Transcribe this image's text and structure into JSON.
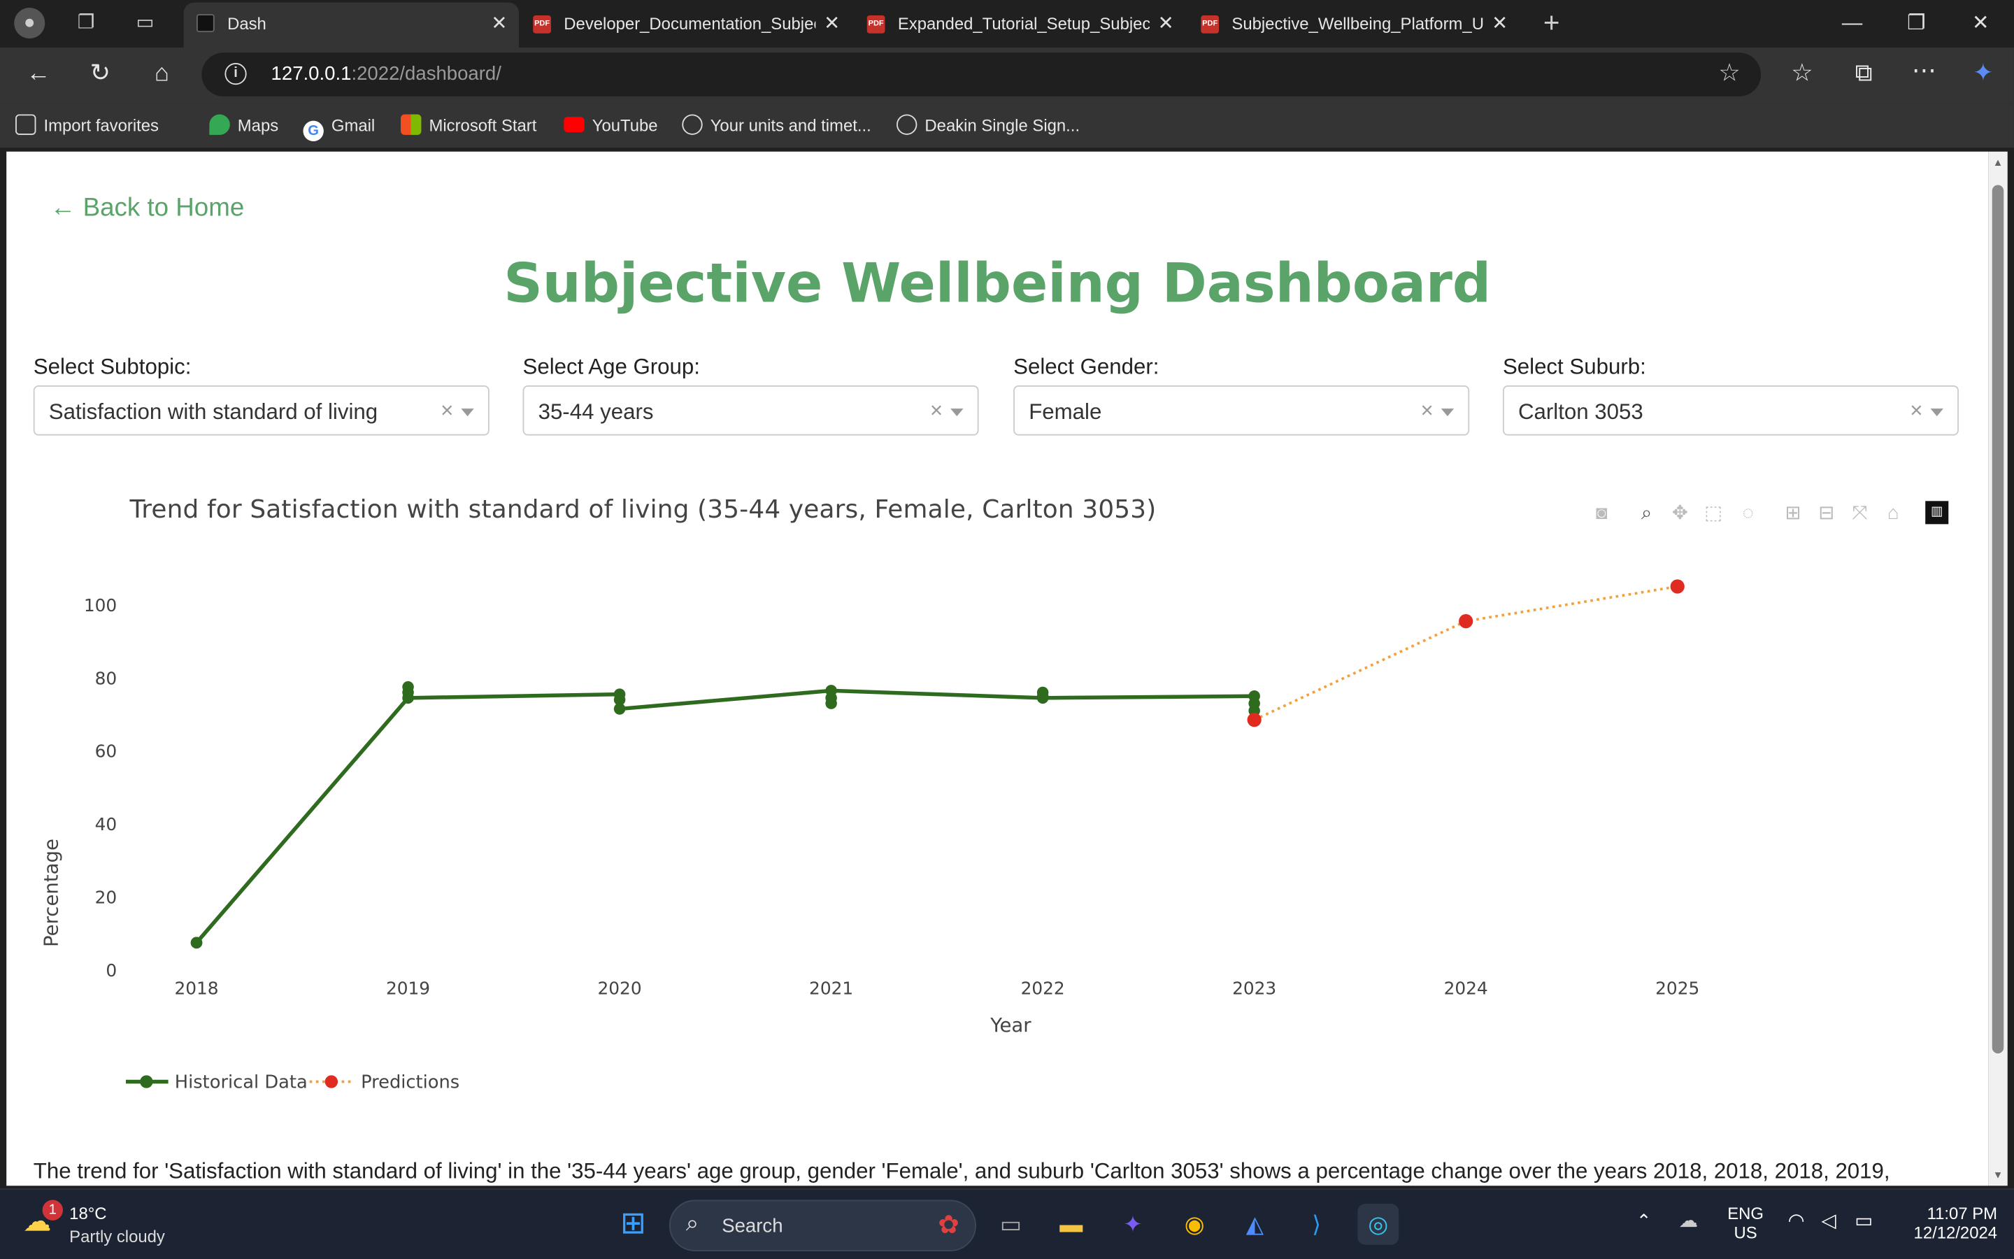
{
  "browser": {
    "tabs": [
      {
        "title": "Dash",
        "active": true
      },
      {
        "title": "Developer_Documentation_Subjec",
        "active": false
      },
      {
        "title": "Expanded_Tutorial_Setup_Subject",
        "active": false
      },
      {
        "title": "Subjective_Wellbeing_Platform_Us",
        "active": false
      }
    ],
    "url_host": "127.0.0.1",
    "url_path": ":2022/dashboard/",
    "bookmarks": [
      "Import favorites",
      "Maps",
      "Gmail",
      "Microsoft Start",
      "YouTube",
      "Your units and timet...",
      "Deakin Single Sign..."
    ]
  },
  "page": {
    "back_link": "← Back to Home",
    "title": "Subjective Wellbeing Dashboard",
    "filters": [
      {
        "label": "Select Subtopic:",
        "value": "Satisfaction with standard of living"
      },
      {
        "label": "Select Age Group:",
        "value": "35-44 years"
      },
      {
        "label": "Select Gender:",
        "value": "Female"
      },
      {
        "label": "Select Suburb:",
        "value": "Carlton 3053"
      }
    ],
    "summary": "The trend for 'Satisfaction with standard of living' in the '35-44 years' age group, gender 'Female', and suburb 'Carlton 3053' shows a percentage change over the years 2018, 2018, 2018, 2019,"
  },
  "chart_data": {
    "type": "line",
    "title": "Trend for Satisfaction with standard of living (35-44 years, Female, Carlton 3053)",
    "xlabel": "Year",
    "ylabel": "Percentage",
    "xlim": [
      2017.83,
      2025.85
    ],
    "ylim": [
      -1,
      108
    ],
    "yticks": [
      0,
      20,
      40,
      60,
      80,
      100
    ],
    "xticks": [
      2018,
      2019,
      2020,
      2021,
      2022,
      2023,
      2024,
      2025
    ],
    "legend_position": "bottom-left",
    "series": [
      {
        "name": "Historical Data",
        "color": "#2f6b1f",
        "style": "solid",
        "points": [
          [
            2018,
            7.5
          ],
          [
            2018,
            7.5
          ],
          [
            2018,
            7.5
          ],
          [
            2019,
            77.5
          ],
          [
            2019,
            76
          ],
          [
            2019,
            74.5
          ],
          [
            2020,
            75.5
          ],
          [
            2020,
            74
          ],
          [
            2020,
            71.5
          ],
          [
            2021,
            76.5
          ],
          [
            2021,
            74.5
          ],
          [
            2021,
            73
          ],
          [
            2022,
            76
          ],
          [
            2022,
            75
          ],
          [
            2022,
            74.5
          ],
          [
            2023,
            75
          ],
          [
            2023,
            73
          ],
          [
            2023,
            71
          ]
        ],
        "line": [
          [
            2018,
            7.5
          ],
          [
            2019,
            74.5
          ],
          [
            2020,
            75.5
          ],
          [
            2020,
            71.5
          ],
          [
            2021,
            76.5
          ],
          [
            2022,
            74.5
          ],
          [
            2023,
            75
          ],
          [
            2023,
            71
          ]
        ]
      },
      {
        "name": "Predictions",
        "color": "#e02b20",
        "line_color": "#f2a03a",
        "style": "dotted",
        "points": [
          [
            2023,
            68.5
          ],
          [
            2024,
            95.5
          ],
          [
            2025,
            105
          ]
        ]
      }
    ]
  },
  "modebar": [
    "camera-icon",
    "zoom-icon",
    "pan-icon",
    "box-select-icon",
    "lasso-icon",
    "zoom-in-icon",
    "zoom-out-icon",
    "autoscale-icon",
    "reset-axes-icon",
    "plotly-logo-icon"
  ],
  "taskbar": {
    "weather_temp": "18°C",
    "weather_desc": "Partly cloudy",
    "weather_badge": "1",
    "search_label": "Search",
    "lang_1": "ENG",
    "lang_2": "US",
    "time": "11:07 PM",
    "date": "12/12/2024"
  }
}
